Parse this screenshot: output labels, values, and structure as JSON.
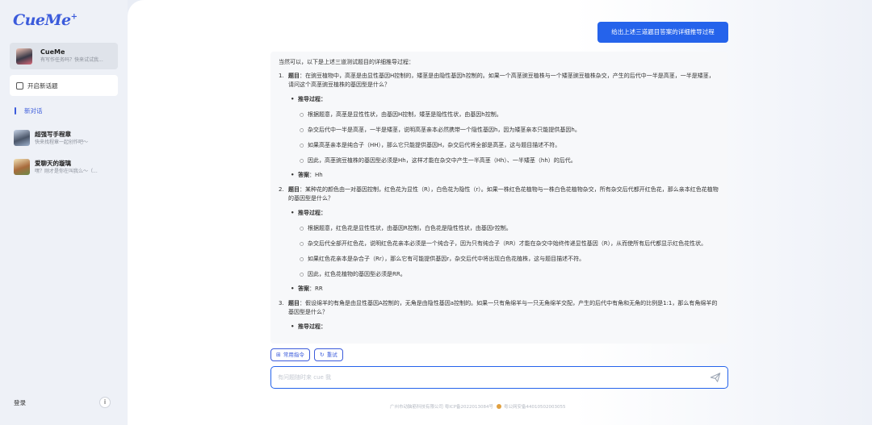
{
  "app": {
    "logo_text": "CueMe"
  },
  "sidebar": {
    "profile": {
      "name": "CueMe",
      "subtitle": "有写作任务吗？快来试试我..."
    },
    "new_chat_label": "开启新话题",
    "active_conversation_label": "新对话",
    "conversations": [
      {
        "name": "超强写手程章",
        "subtitle": "快来找程章一起创作吧～"
      },
      {
        "name": "爱聊天的璇璃",
        "subtitle": "嘿？刚才是你在叫我么～（..."
      }
    ],
    "login_label": "登录",
    "info_icon": "i"
  },
  "chat": {
    "user_message": "给出上述三道题目答案的详细推导过程",
    "intro": "当然可以，以下是上述三道测试题目的详细推导过程：",
    "questions": [
      {
        "num": "1.",
        "title_label": "题目",
        "title_text": "：在豌豆植物中，高茎是由显性基因H控制的，矮茎是由隐性基因h控制的。如果一个高茎豌豆植株与一个矮茎豌豆植株杂交，产生的后代中一半是高茎，一半是矮茎，请问这个高茎豌豆植株的基因型是什么？",
        "process_label": "推导过程：",
        "steps": [
          "根据题意，高茎是显性性状，由基因H控制，矮茎是隐性性状，由基因h控制。",
          "杂交后代中一半是高茎，一半是矮茎，说明高茎亲本必然携带一个隐性基因h，因为矮茎亲本只能提供基因h。",
          "如果高茎亲本是纯合子（HH），那么它只能提供基因H，杂交后代将全部是高茎，这与题目描述不符。",
          "因此，高茎豌豆植株的基因型必须是Hh，这样才能在杂交中产生一半高茎（Hh）、一半矮茎（hh）的后代。"
        ],
        "answer_label": "答案",
        "answer_text": "：Hh"
      },
      {
        "num": "2.",
        "title_label": "题目",
        "title_text": "：某种花的颜色由一对基因控制，红色花为显性（R），白色花为隐性（r）。如果一株红色花植物与一株白色花植物杂交，所有杂交后代都开红色花，那么亲本红色花植物的基因型是什么？",
        "process_label": "推导过程：",
        "steps": [
          "根据题意，红色花是显性性状，由基因R控制，白色花是隐性性状，由基因r控制。",
          "杂交后代全部开红色花，说明红色花亲本必须是一个纯合子，因为只有纯合子（RR）才能在杂交中始终传递显性基因（R），从而使所有后代都显示红色花性状。",
          "如果红色花亲本是杂合子（Rr），那么它有可能提供基因r，杂交后代中将出现白色花植株，这与题目描述不符。",
          "因此，红色花植物的基因型必须是RR。"
        ],
        "answer_label": "答案",
        "answer_text": "：RR"
      },
      {
        "num": "3.",
        "title_label": "题目",
        "title_text": "：假设绵羊的有角是由显性基因A控制的，无角是由隐性基因a控制的。如果一只有角绵羊与一只无角绵羊交配，产生的后代中有角和无角的比例是1:1，那么有角绵羊的基因型是什么？",
        "process_label": "推导过程："
      }
    ]
  },
  "actions": {
    "common_commands_label": "常用指令",
    "retry_label": "重试"
  },
  "input": {
    "placeholder": "有问题随时来 cue 我",
    "value": ""
  },
  "footer": {
    "icp_text": "广州市动脑筋科技有限公司 粤ICP备2022013084号",
    "police_text": "粤公网安备44010502003055"
  },
  "colors": {
    "accent": "#2563eb",
    "sidebar_bg": "#eef1f7"
  }
}
